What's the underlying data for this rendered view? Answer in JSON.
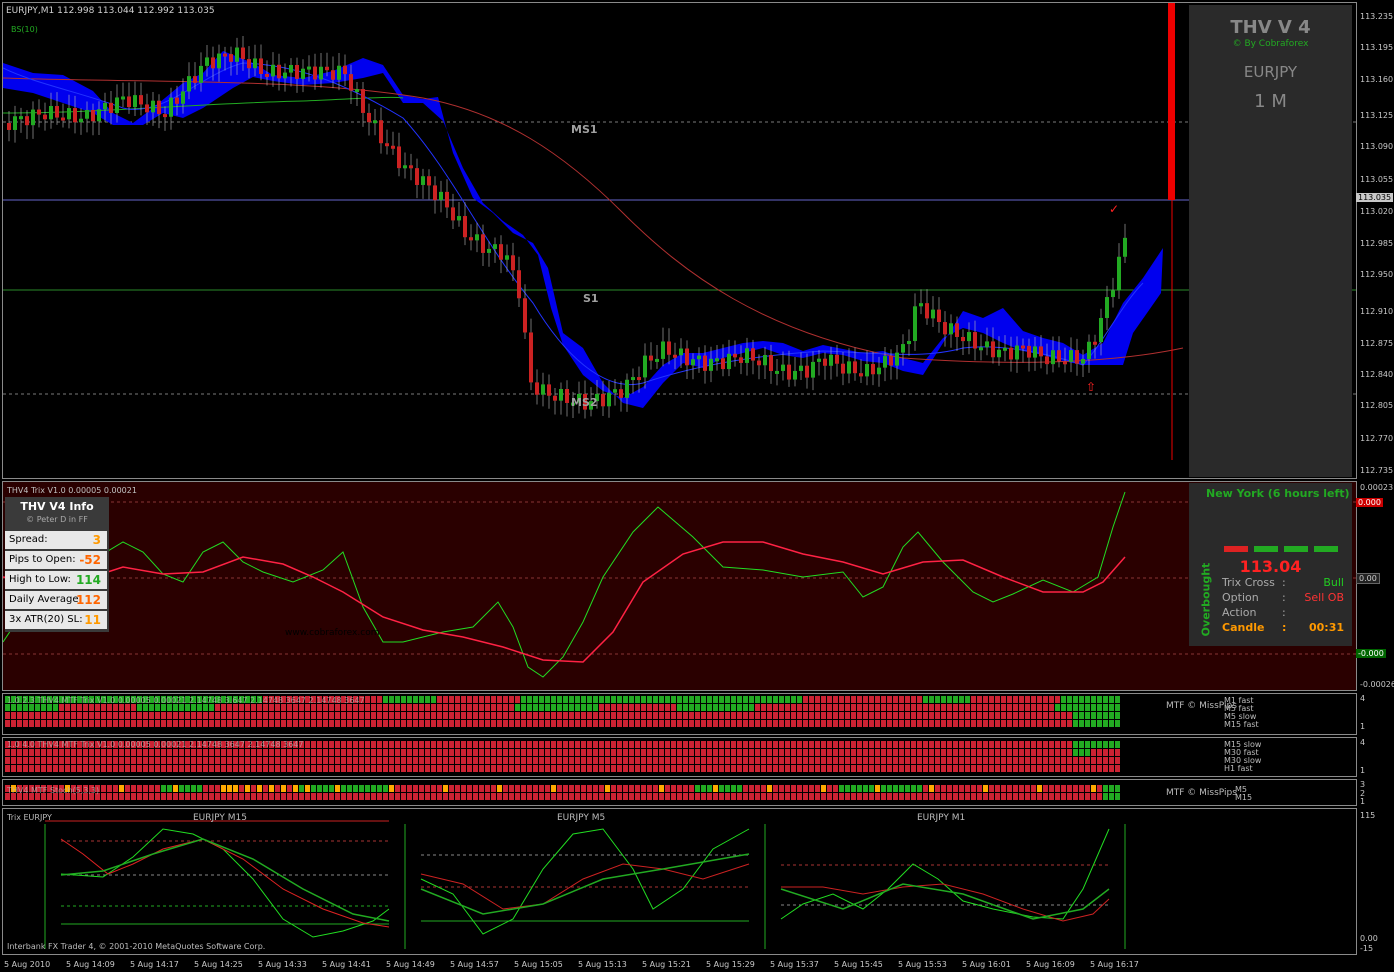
{
  "main": {
    "symbol_line": "EURJPY,M1  112.998 113.044 112.992 113.035",
    "subline": "BS(10)",
    "level_labels": {
      "ms1": "MS1",
      "s1": "S1",
      "ms2": "MS2"
    },
    "price_axis": [
      "113.235",
      "113.195",
      "113.160",
      "113.125",
      "113.090",
      "113.055",
      "113.035",
      "113.020",
      "112.985",
      "112.950",
      "112.910",
      "112.875",
      "112.840",
      "112.805",
      "112.770",
      "112.735"
    ],
    "current_price": "113.035"
  },
  "thv_panel": {
    "title": "THV V 4",
    "by": "© By Cobraforex",
    "symbol": "EURJPY",
    "timeframe": "1 M"
  },
  "trix": {
    "header": "THV4 Trix V1.0 0.00005 0.00021",
    "watermark": "www.cobraforex.com",
    "axis": {
      "top": "0.00023",
      "upper": "0.000",
      "zero": "0.00",
      "lower": "-0.000",
      "bottom": "-0.00026"
    }
  },
  "info_box": {
    "title": "THV  V4  Info",
    "author": "© Peter D  in  FF",
    "rows": [
      {
        "label": "Spread:",
        "value": "3",
        "color": "#ff9900"
      },
      {
        "label": "Pips to Open:",
        "value": "-52",
        "color": "#ff6600"
      },
      {
        "label": "High to Low:",
        "value": "114",
        "color": "#22aa22"
      },
      {
        "label": "Daily Average:",
        "value": "112",
        "color": "#ff6600"
      },
      {
        "label": "3x ATR(20) SL:",
        "value": "11",
        "color": "#ff9900"
      }
    ]
  },
  "ny_box": {
    "session": "New York    (6 hours left)",
    "side_label": "Overbought",
    "price": "113.04",
    "rows": [
      {
        "label": "Trix Cross",
        "sep": ":",
        "value": "Bull",
        "color": "#22cc22"
      },
      {
        "label": "Option",
        "sep": ":",
        "value": "Sell OB",
        "color": "#ff3333"
      },
      {
        "label": "Action",
        "sep": ":",
        "value": "",
        "color": "#cccccc"
      },
      {
        "label": "Candle",
        "sep": ":",
        "value": "00:31",
        "color": "#ff9900"
      }
    ]
  },
  "mtf": {
    "row1_header": "1.0 2.3 THV4 MTF Trix V1.0 0.00005 0.00021 2.14748 3.647 2.14748 3647 2.14748 3647",
    "row1_title": "MTF © MissPips",
    "row1_labels": [
      "M1 fast",
      "M5 fast",
      "M5 slow",
      "M15 fast"
    ],
    "row1_axis": [
      "4",
      "1"
    ],
    "row2_header": "1.0 4.0 THV4 MTF Trix V1.0 0.00005 0.00021 2.14748 3647 2.14748 3647",
    "row2_labels": [
      "M15 slow",
      "M30 fast",
      "M30 slow",
      "H1 fast"
    ],
    "row2_axis": [
      "4",
      "1"
    ],
    "row3_header": "THV4 MTF Stoch(5,3,3)",
    "row3_title": "MTF © MissPips",
    "row3_labels": [
      "M5",
      "M15"
    ],
    "row3_axis": [
      "3",
      "2",
      "1"
    ]
  },
  "mini": {
    "title_left": "Trix EURJPY",
    "charts": [
      "EURJPY M15",
      "EURJPY M5",
      "EURJPY M1"
    ],
    "axis_top": "115",
    "axis_zero": "0.00",
    "axis_bottom": "-15",
    "footer": "Interbank FX Trader 4, © 2001-2010 MetaQuotes Software Corp."
  },
  "time_axis": [
    "5 Aug 2010",
    "5 Aug 14:09",
    "5 Aug 14:17",
    "5 Aug 14:25",
    "5 Aug 14:33",
    "5 Aug 14:41",
    "5 Aug 14:49",
    "5 Aug 14:57",
    "5 Aug 15:05",
    "5 Aug 15:13",
    "5 Aug 15:21",
    "5 Aug 15:29",
    "5 Aug 15:37",
    "5 Aug 15:45",
    "5 Aug 15:53",
    "5 Aug 16:01",
    "5 Aug 16:09",
    "5 Aug 16:17"
  ]
}
